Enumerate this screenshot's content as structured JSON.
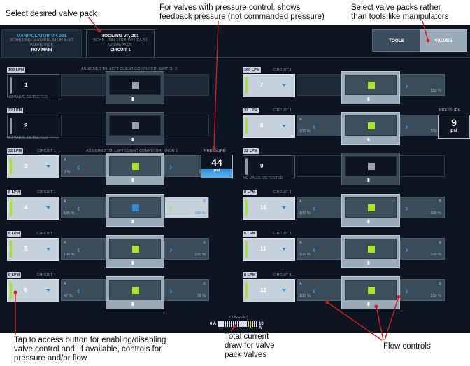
{
  "callouts": {
    "select_pack": "Select desired valve pack",
    "pressure_line1": "For valves with pressure control, shows",
    "pressure_line2": "feedback pressure (not commanded pressure)",
    "select_tools_line1": "Select valve packs rather",
    "select_tools_line2": "than tools like manipulators",
    "tap_line1": "Tap to access button for enabling/disabling",
    "tap_line2": "valve control and, if available, controls for",
    "tap_line3": "pressure and/or flow",
    "current_line1": "Total current",
    "current_line2": "draw for valve",
    "current_line3": "pack valves",
    "flow_controls": "Flow controls"
  },
  "tabs": {
    "manipulator": {
      "title": "MANIPULATOR VP, 301",
      "sub1": "SCHILLING MANIPULATOR 6-ST",
      "sub2": "VALVEPACK",
      "sub3": "ROV MAIN"
    },
    "tooling": {
      "title": "TOOLING VP, 201",
      "sub1": "SCHILLING TOOLING 12-ST",
      "sub2": "VALVEPACK",
      "sub3": "CIRCUIT 1"
    }
  },
  "segment": {
    "tools": "TOOLS",
    "valves": "VALVES"
  },
  "valves": [
    {
      "num": "1",
      "lpm": "160 LPM",
      "circuit": "",
      "status": "NO VALVE DETECTED",
      "a_val": "",
      "b_val": "",
      "a": "",
      "b": ""
    },
    {
      "num": "2",
      "lpm": "32 LPM",
      "circuit": "",
      "status": "NO VALVE DETECTED",
      "a_val": "",
      "b_val": "",
      "a": "",
      "b": ""
    },
    {
      "num": "3",
      "lpm": "32 LPM",
      "circuit": "CIRCUIT 1",
      "status": "",
      "a_val": "0 %",
      "b_val": "0 %",
      "a": "A",
      "b": "B"
    },
    {
      "num": "4",
      "lpm": "8 LPM",
      "circuit": "CIRCUIT 1",
      "status": "",
      "a_val": "100 %",
      "b_val": "100 %",
      "a": "A",
      "b": "B"
    },
    {
      "num": "5",
      "lpm": "8 LPM",
      "circuit": "CIRCUIT 1",
      "status": "",
      "a_val": "100 %",
      "b_val": "100 %",
      "a": "A",
      "b": "B"
    },
    {
      "num": "6",
      "lpm": "8 LPM",
      "circuit": "CIRCUIT 1",
      "status": "",
      "a_val": "47 %",
      "b_val": "78 %",
      "a": "A",
      "b": "B"
    },
    {
      "num": "7",
      "lpm": "160 LPM",
      "circuit": "CIRCUIT 1",
      "status": "",
      "a_val": "",
      "b_val": "100 %",
      "a": "",
      "b": ""
    },
    {
      "num": "8",
      "lpm": "32 LPM",
      "circuit": "CIRCUIT 1",
      "status": "",
      "a_val": "100 %",
      "b_val": "100 %",
      "a": "A",
      "b": "B"
    },
    {
      "num": "9",
      "lpm": "32 LPM",
      "circuit": "",
      "status": "NO VALVE DETECTED",
      "a_val": "",
      "b_val": "",
      "a": "",
      "b": ""
    },
    {
      "num": "10",
      "lpm": "8 LPM",
      "circuit": "CIRCUIT 1",
      "status": "",
      "a_val": "100 %",
      "b_val": "100 %",
      "a": "A",
      "b": "B"
    },
    {
      "num": "11",
      "lpm": "8 LPM",
      "circuit": "CIRCUIT 1",
      "status": "",
      "a_val": "100 %",
      "b_val": "100 %",
      "a": "A",
      "b": "B"
    },
    {
      "num": "12",
      "lpm": "8 LPM",
      "circuit": "CIRCUIT 1",
      "status": "",
      "a_val": "100 %",
      "b_val": "100 %",
      "a": "A",
      "b": "B"
    }
  ],
  "assign1": "ASSIGNED TO: LEFT CLIENT COMPUTER, SWITCH 2",
  "assign3": "ASSIGNED TO: LEFT CLIENT COMPUTER, KNOB 2",
  "pressure_3": {
    "label": "PRESSURE",
    "value": "44",
    "unit": "psi"
  },
  "pressure_8": {
    "label": "PRESSURE",
    "value": "9",
    "unit": "psi"
  },
  "grip_glyph": "III",
  "chevron_left": "‹",
  "chevron_right": "›",
  "current": {
    "label": "CURRENT",
    "min": "0 A",
    "max": "10 A"
  },
  "colors": {
    "accent_green": "#a7e62b",
    "accent_blue": "#2e8fd6",
    "panel_bg": "#0d1620"
  }
}
